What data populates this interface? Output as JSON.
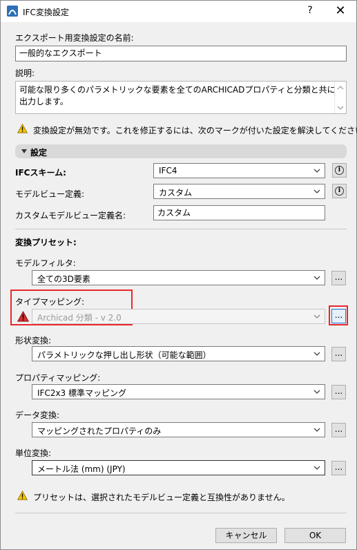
{
  "window": {
    "title": "IFC変換設定",
    "help": "?",
    "close": "✕"
  },
  "name": {
    "label": "エクスポート用変換設定の名前:",
    "value": "一般的なエクスポート"
  },
  "description": {
    "label": "説明:",
    "value": "可能な限り多くのパラメトリックな要素を全てのARCHICADプロパティと分類と共に出力します。"
  },
  "warning_top": "変換設定が無効です。これを修正するには、次のマークが付いた設定を解決してください。",
  "settings_section": "設定",
  "ifc_schema": {
    "label": "IFCスキーム:",
    "value": "IFC4"
  },
  "model_view": {
    "label": "モデルビュー定義:",
    "value": "カスタム"
  },
  "custom_mvd_name": {
    "label": "カスタムモデルビュー定義名:",
    "value": "カスタム"
  },
  "presets_header": "変換プリセット:",
  "model_filter": {
    "label": "モデルフィルタ:",
    "value": "全ての3D要素"
  },
  "type_mapping": {
    "label": "タイプマッピング:",
    "value": "Archicad 分類 - v 2.0"
  },
  "geometry": {
    "label": "形状変換:",
    "value": "パラメトリックな押し出し形状（可能な範囲）"
  },
  "property_mapping": {
    "label": "プロパティマッピング:",
    "value": "IFC2x3 標準マッピング"
  },
  "data_conversion": {
    "label": "データ変換:",
    "value": "マッピングされたプロパティのみ"
  },
  "units": {
    "label": "単位変換:",
    "value": "メートル法 (mm) (JPY)"
  },
  "warning_bottom": "プリセットは、選択されたモデルビュー定義と互換性がありません。",
  "buttons": {
    "browse": "...",
    "cancel": "キャンセル",
    "ok": "OK"
  },
  "colors": {
    "highlight_red": "#e8262b",
    "focus_blue": "#1e6fd9",
    "warning_yellow": "#f5c400",
    "error_red": "#d32f2f"
  }
}
